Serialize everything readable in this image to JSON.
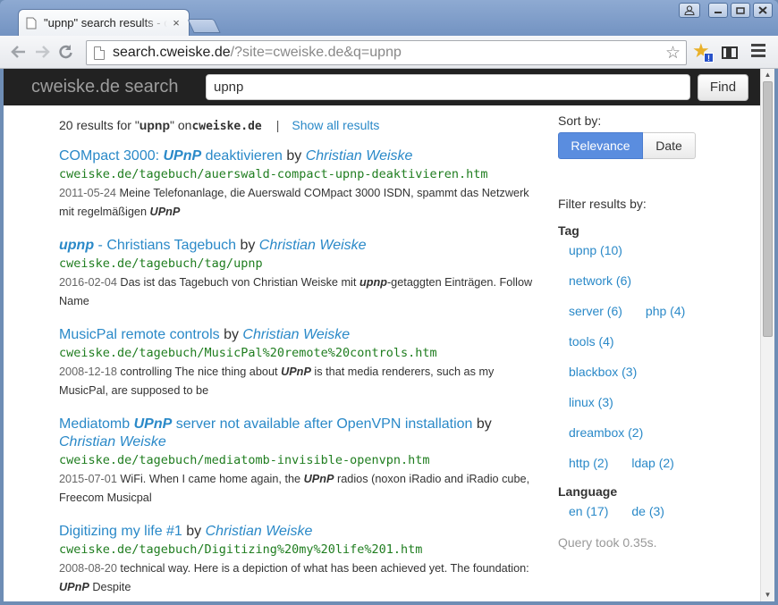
{
  "browser": {
    "tab_title": "\"upnp\" search results - c",
    "tab_close": "×",
    "url_host": "search.cweiske.de",
    "url_path": "/?site=cweiske.de&q=upnp",
    "ext_badge": "!",
    "icons": [
      "back-icon",
      "forward-icon",
      "reload-icon",
      "bookmark-star-icon",
      "extension-star-icon",
      "reader-icon",
      "menu-icon",
      "user-icon",
      "minimize-icon",
      "maximize-icon",
      "close-icon"
    ]
  },
  "header": {
    "brand": "cweiske.de search",
    "query": "upnp",
    "find_label": "Find"
  },
  "summary": {
    "prefix": "20 results for \"",
    "query": "upnp",
    "middle": "\" on ",
    "site": "cweiske.de",
    "separator": "|",
    "show_all": "Show all results"
  },
  "results": [
    {
      "title_pre": "COMpact 3000: ",
      "title_hl": "UPnP",
      "title_post": " deaktivieren",
      "by": " by ",
      "author": "Christian Weiske",
      "url": "cweiske.de/tagebuch/auerswald-compact-upnp-deaktivieren.htm",
      "date": "2011-05-24",
      "snippet_pre": " Meine Telefonanlage, die Auerswald COMpact 3000 ISDN, spammt das Netzwerk mit regelmäßigen ",
      "snippet_hl": "UPnP",
      "snippet_post": ""
    },
    {
      "title_pre": "",
      "title_hl": "upnp",
      "title_post": " - Christians Tagebuch",
      "by": " by ",
      "author": "Christian Weiske",
      "url": "cweiske.de/tagebuch/tag/upnp",
      "date": "2016-02-04",
      "snippet_pre": " Das ist das Tagebuch von Christian Weiske mit ",
      "snippet_hl": "upnp",
      "snippet_post": "-getaggten Einträgen. Follow Name"
    },
    {
      "title_pre": "MusicPal remote controls",
      "title_hl": "",
      "title_post": "",
      "by": " by ",
      "author": "Christian Weiske",
      "url": "cweiske.de/tagebuch/MusicPal%20remote%20controls.htm",
      "date": "2008-12-18",
      "snippet_pre": " controlling The nice thing about ",
      "snippet_hl": "UPnP",
      "snippet_post": " is that media renderers, such as my MusicPal, are supposed to be"
    },
    {
      "title_pre": "Mediatomb ",
      "title_hl": "UPnP",
      "title_post": " server not available after OpenVPN installation",
      "by": " by ",
      "author": "Christian Weiske",
      "url": "cweiske.de/tagebuch/mediatomb-invisible-openvpn.htm",
      "date": "2015-07-01",
      "snippet_pre": " WiFi.  When I came home again, the ",
      "snippet_hl": "UPnP",
      "snippet_post": " radios (noxon iRadio and iRadio cube, Freecom Musicpal"
    },
    {
      "title_pre": "Digitizing my life #1",
      "title_hl": "",
      "title_post": "",
      "by": " by ",
      "author": "Christian Weiske",
      "url": "cweiske.de/tagebuch/Digitizing%20my%20life%201.htm",
      "date": "2008-08-20",
      "snippet_pre": " technical way. Here is a depiction of what has been achieved yet. The foundation: ",
      "snippet_hl": "UPnP",
      "snippet_post": " Despite"
    }
  ],
  "sidebar": {
    "sort_label": "Sort by:",
    "sort_relevance": "Relevance",
    "sort_date": "Date",
    "filter_title": "Filter results by:",
    "tag_heading": "Tag",
    "tags": [
      [
        "upnp (10)"
      ],
      [
        "network (6)"
      ],
      [
        "server (6)",
        "php (4)"
      ],
      [
        "tools (4)"
      ],
      [
        "blackbox (3)"
      ],
      [
        "linux (3)"
      ],
      [
        "dreambox (2)"
      ],
      [
        "http (2)",
        "ldap (2)"
      ]
    ],
    "language_heading": "Language",
    "languages": [
      "en (17)",
      "de (3)"
    ],
    "query_time": "Query took 0.35s."
  }
}
